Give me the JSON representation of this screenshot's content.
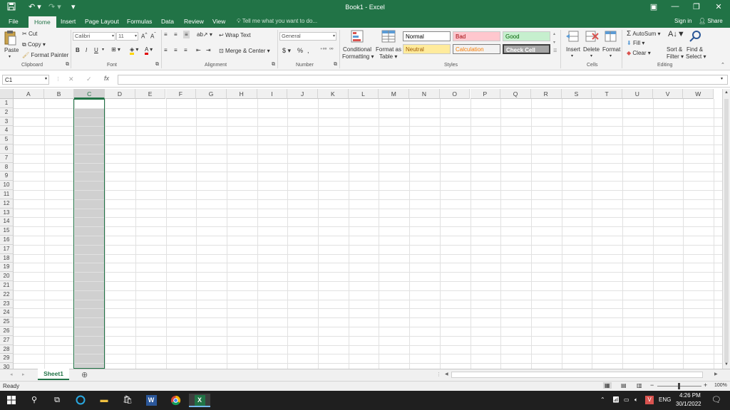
{
  "titlebar": {
    "title": "Book1  -  Excel",
    "save_icon": "save-icon",
    "undo_icon": "undo-icon",
    "redo_icon": "redo-icon"
  },
  "tabs": [
    {
      "label": "File"
    },
    {
      "label": "Home"
    },
    {
      "label": "Insert"
    },
    {
      "label": "Page Layout"
    },
    {
      "label": "Formulas"
    },
    {
      "label": "Data"
    },
    {
      "label": "Review"
    },
    {
      "label": "View"
    }
  ],
  "tellme": "Tell me what you want to do...",
  "signin": "Sign in",
  "share": "Share",
  "ribbon": {
    "clipboard": {
      "label": "Clipboard",
      "paste": "Paste",
      "cut": "Cut",
      "copy": "Copy",
      "format_painter": "Format Painter"
    },
    "font": {
      "label": "Font",
      "name": "Calibri",
      "size": "11",
      "bold": "B",
      "italic": "I",
      "underline": "U"
    },
    "alignment": {
      "label": "Alignment",
      "wrap": "Wrap Text",
      "merge": "Merge & Center"
    },
    "number": {
      "label": "Number",
      "format": "General",
      "currency": "$",
      "percent": "%",
      "comma": ","
    },
    "styles": {
      "label": "Styles",
      "conditional": "Conditional",
      "formatting": "Formatting",
      "format_as": "Format as",
      "table": "Table",
      "normal": "Normal",
      "bad": "Bad",
      "good": "Good",
      "neutral": "Neutral",
      "calculation": "Calculation",
      "check_cell": "Check Cell"
    },
    "cells": {
      "label": "Cells",
      "insert": "Insert",
      "delete": "Delete",
      "format": "Format"
    },
    "editing": {
      "label": "Editing",
      "autosum": "AutoSum",
      "fill": "Fill",
      "clear": "Clear",
      "sort": "Sort &",
      "filter": "Filter",
      "find": "Find &",
      "select": "Select"
    }
  },
  "formula_bar": {
    "name_box": "C1",
    "fx": "fx",
    "value": ""
  },
  "grid": {
    "columns": [
      "A",
      "B",
      "C",
      "D",
      "E",
      "F",
      "G",
      "H",
      "I",
      "J",
      "K",
      "L",
      "M",
      "N",
      "O",
      "P",
      "Q",
      "R",
      "S",
      "T",
      "U",
      "V",
      "W"
    ],
    "rows": [
      "1",
      "2",
      "3",
      "4",
      "5",
      "6",
      "7",
      "8",
      "9",
      "10",
      "11",
      "12",
      "13",
      "14",
      "15",
      "16",
      "17",
      "18",
      "19",
      "20",
      "21",
      "22",
      "23",
      "24",
      "25",
      "26",
      "27",
      "28",
      "29",
      "30"
    ],
    "selected_column": "C"
  },
  "sheets": [
    {
      "label": "Sheet1"
    }
  ],
  "status": {
    "ready": "Ready",
    "zoom": "100%"
  },
  "taskbar": {
    "time": "4:26 PM",
    "date": "30/1/2022",
    "lang": "ENG"
  },
  "colors": {
    "excel_green": "#217346",
    "bad_bg": "#ffc7ce",
    "bad_fg": "#9c0006",
    "good_bg": "#c6efce",
    "good_fg": "#006100",
    "neutral_bg": "#ffeb9c",
    "neutral_fg": "#9c5700",
    "calc_fg": "#fa7d00",
    "check_bg": "#a5a5a5"
  }
}
